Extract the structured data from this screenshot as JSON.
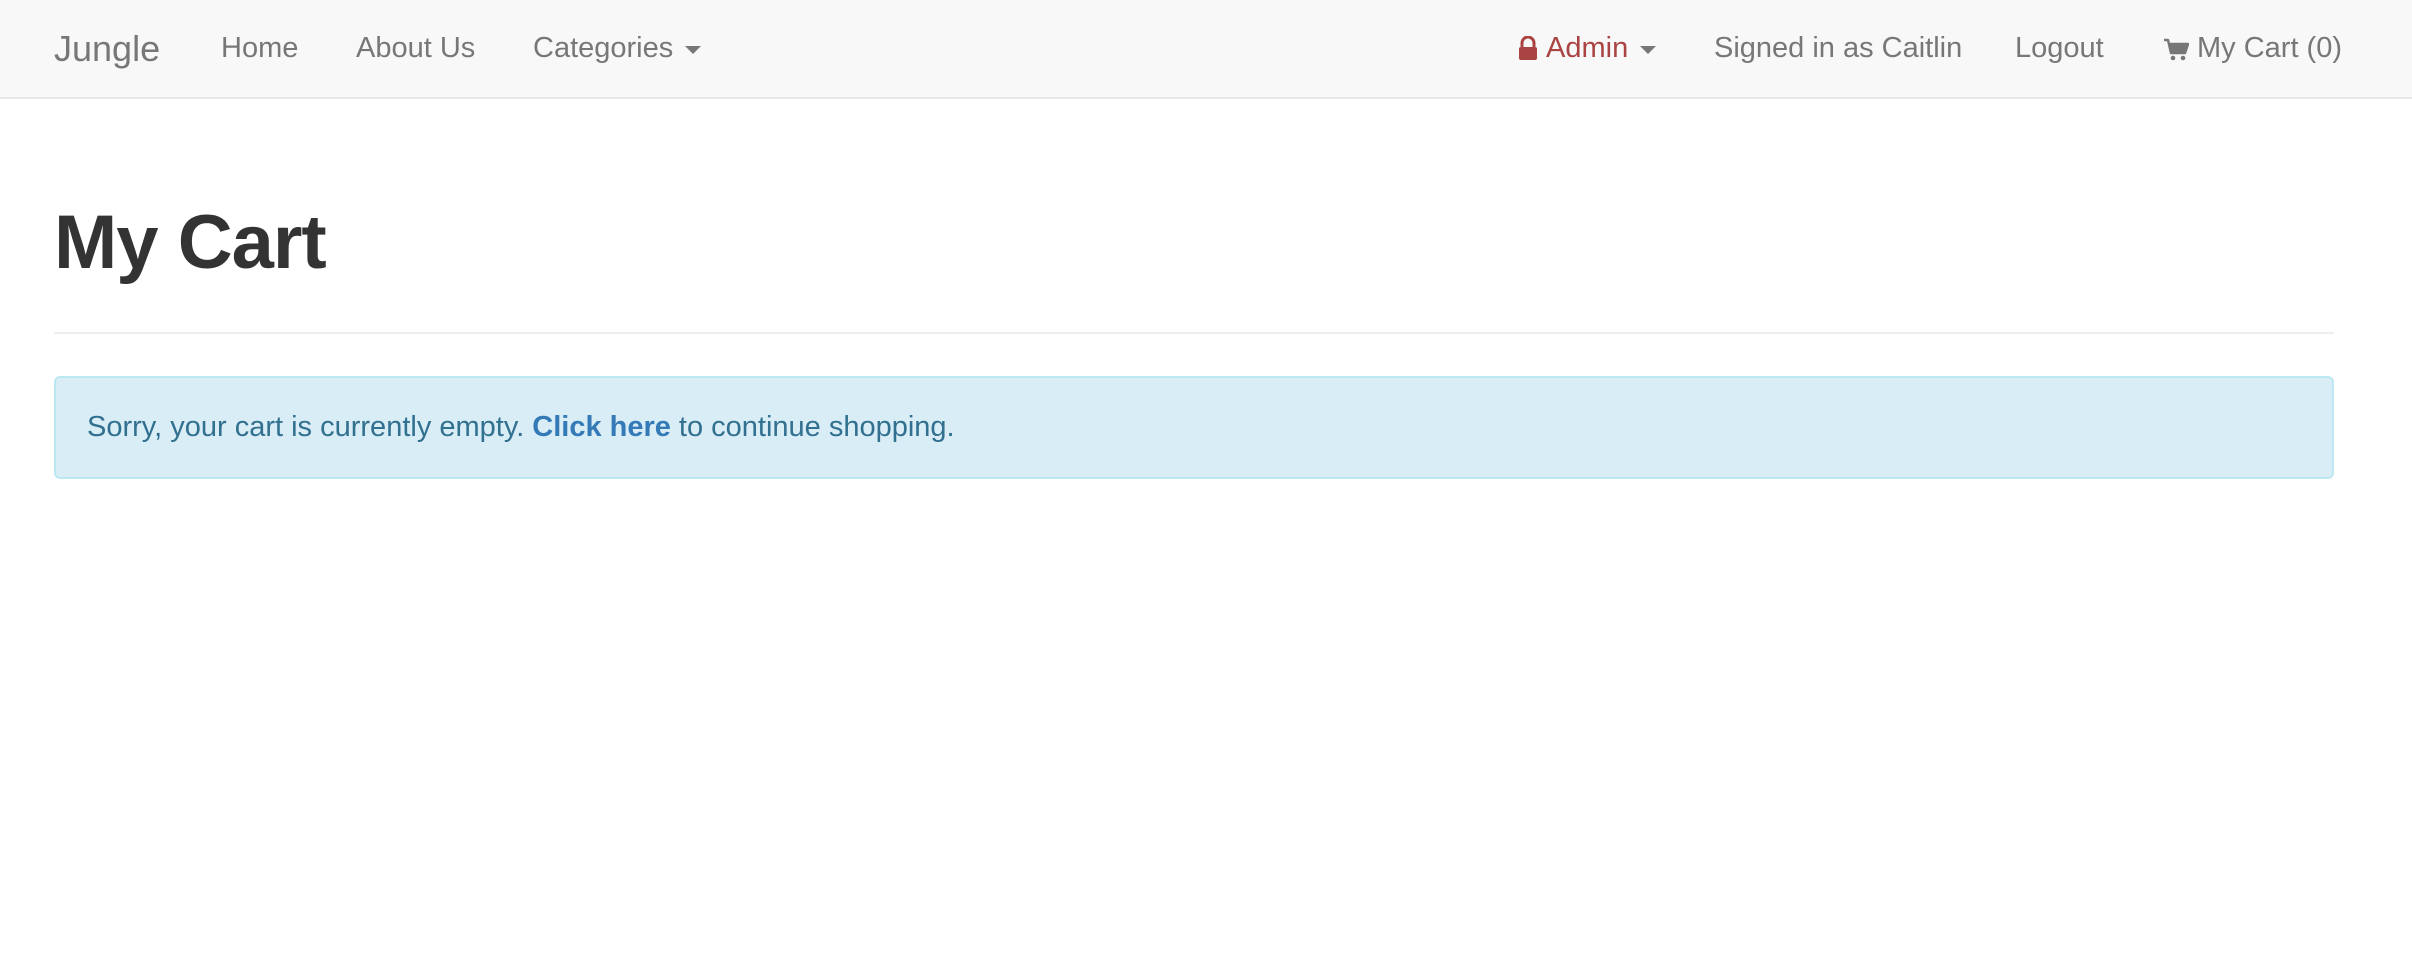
{
  "navbar": {
    "brand": "Jungle",
    "home": "Home",
    "about": "About Us",
    "categories": "Categories",
    "admin": "Admin",
    "signed_in": "Signed in as Caitlin",
    "logout": "Logout",
    "cart": "My Cart (0)"
  },
  "main": {
    "title": "My Cart",
    "alert": {
      "prefix": "Sorry, your cart is currently empty.",
      "link": "Click here",
      "suffix": "to continue shopping."
    }
  },
  "colors": {
    "navbar_bg": "#f8f8f8",
    "admin": "#a94442",
    "alert_bg": "#d9edf7",
    "alert_text": "#31708f"
  },
  "icons": {
    "admin": "lock-icon",
    "cart": "shopping-cart-icon",
    "dropdown": "caret-down-icon"
  }
}
